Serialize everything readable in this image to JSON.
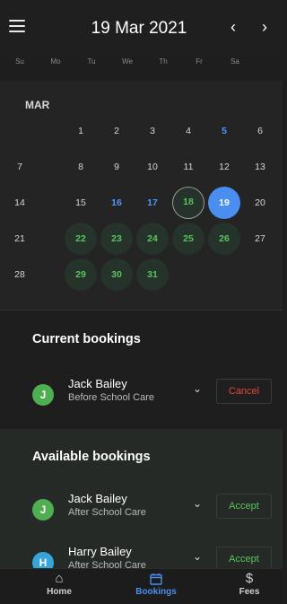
{
  "header": {
    "title": "19 Mar 2021",
    "prev": "‹",
    "next": "›"
  },
  "weekdays": [
    "Su",
    "Mo",
    "Tu",
    "We",
    "Th",
    "Fr",
    "Sa"
  ],
  "calendar": {
    "month": "MAR",
    "days": [
      {
        "n": "1",
        "col": 1,
        "row": 0,
        "state": "normal"
      },
      {
        "n": "2",
        "col": 2,
        "row": 0,
        "state": "normal"
      },
      {
        "n": "3",
        "col": 3,
        "row": 0,
        "state": "normal"
      },
      {
        "n": "4",
        "col": 4,
        "row": 0,
        "state": "normal"
      },
      {
        "n": "5",
        "col": 5,
        "row": 0,
        "state": "blue"
      },
      {
        "n": "6",
        "col": 6,
        "row": 0,
        "state": "normal"
      },
      {
        "n": "7",
        "col": 0,
        "row": 1,
        "state": "normal"
      },
      {
        "n": "8",
        "col": 1,
        "row": 1,
        "state": "normal"
      },
      {
        "n": "9",
        "col": 2,
        "row": 1,
        "state": "normal"
      },
      {
        "n": "10",
        "col": 3,
        "row": 1,
        "state": "normal"
      },
      {
        "n": "11",
        "col": 4,
        "row": 1,
        "state": "normal"
      },
      {
        "n": "12",
        "col": 5,
        "row": 1,
        "state": "normal"
      },
      {
        "n": "13",
        "col": 6,
        "row": 1,
        "state": "normal"
      },
      {
        "n": "14",
        "col": 0,
        "row": 2,
        "state": "normal"
      },
      {
        "n": "15",
        "col": 1,
        "row": 2,
        "state": "normal"
      },
      {
        "n": "16",
        "col": 2,
        "row": 2,
        "state": "blue"
      },
      {
        "n": "17",
        "col": 3,
        "row": 2,
        "state": "blue"
      },
      {
        "n": "18",
        "col": 4,
        "row": 2,
        "state": "today"
      },
      {
        "n": "19",
        "col": 5,
        "row": 2,
        "state": "selected"
      },
      {
        "n": "20",
        "col": 6,
        "row": 2,
        "state": "normal"
      },
      {
        "n": "21",
        "col": 0,
        "row": 3,
        "state": "normal"
      },
      {
        "n": "22",
        "col": 1,
        "row": 3,
        "state": "green"
      },
      {
        "n": "23",
        "col": 2,
        "row": 3,
        "state": "green"
      },
      {
        "n": "24",
        "col": 3,
        "row": 3,
        "state": "green"
      },
      {
        "n": "25",
        "col": 4,
        "row": 3,
        "state": "green"
      },
      {
        "n": "26",
        "col": 5,
        "row": 3,
        "state": "green"
      },
      {
        "n": "27",
        "col": 6,
        "row": 3,
        "state": "normal"
      },
      {
        "n": "28",
        "col": 0,
        "row": 4,
        "state": "normal"
      },
      {
        "n": "29",
        "col": 1,
        "row": 4,
        "state": "green"
      },
      {
        "n": "30",
        "col": 2,
        "row": 4,
        "state": "green"
      },
      {
        "n": "31",
        "col": 3,
        "row": 4,
        "state": "green"
      }
    ]
  },
  "current": {
    "title": "Current bookings",
    "items": [
      {
        "initial": "J",
        "name": "Jack Bailey",
        "type": "Before School Care",
        "action": "Cancel",
        "avatar_color": "green"
      }
    ]
  },
  "available": {
    "title": "Available bookings",
    "items": [
      {
        "initial": "J",
        "name": "Jack Bailey",
        "type": "After School Care",
        "action": "Accept",
        "avatar_color": "green"
      },
      {
        "initial": "H",
        "name": "Harry Bailey",
        "type": "After School Care",
        "action": "Accept",
        "avatar_color": "blue"
      }
    ]
  },
  "nav": [
    {
      "label": "Home",
      "icon": "home-icon",
      "active": false
    },
    {
      "label": "Bookings",
      "icon": "calendar-icon",
      "active": true
    },
    {
      "label": "Fees",
      "icon": "dollar-icon",
      "active": false
    }
  ],
  "colors": {
    "accent_blue": "#4a8ff0",
    "green": "#58c460",
    "red": "#e8453c",
    "background": "#1e1e1e"
  }
}
